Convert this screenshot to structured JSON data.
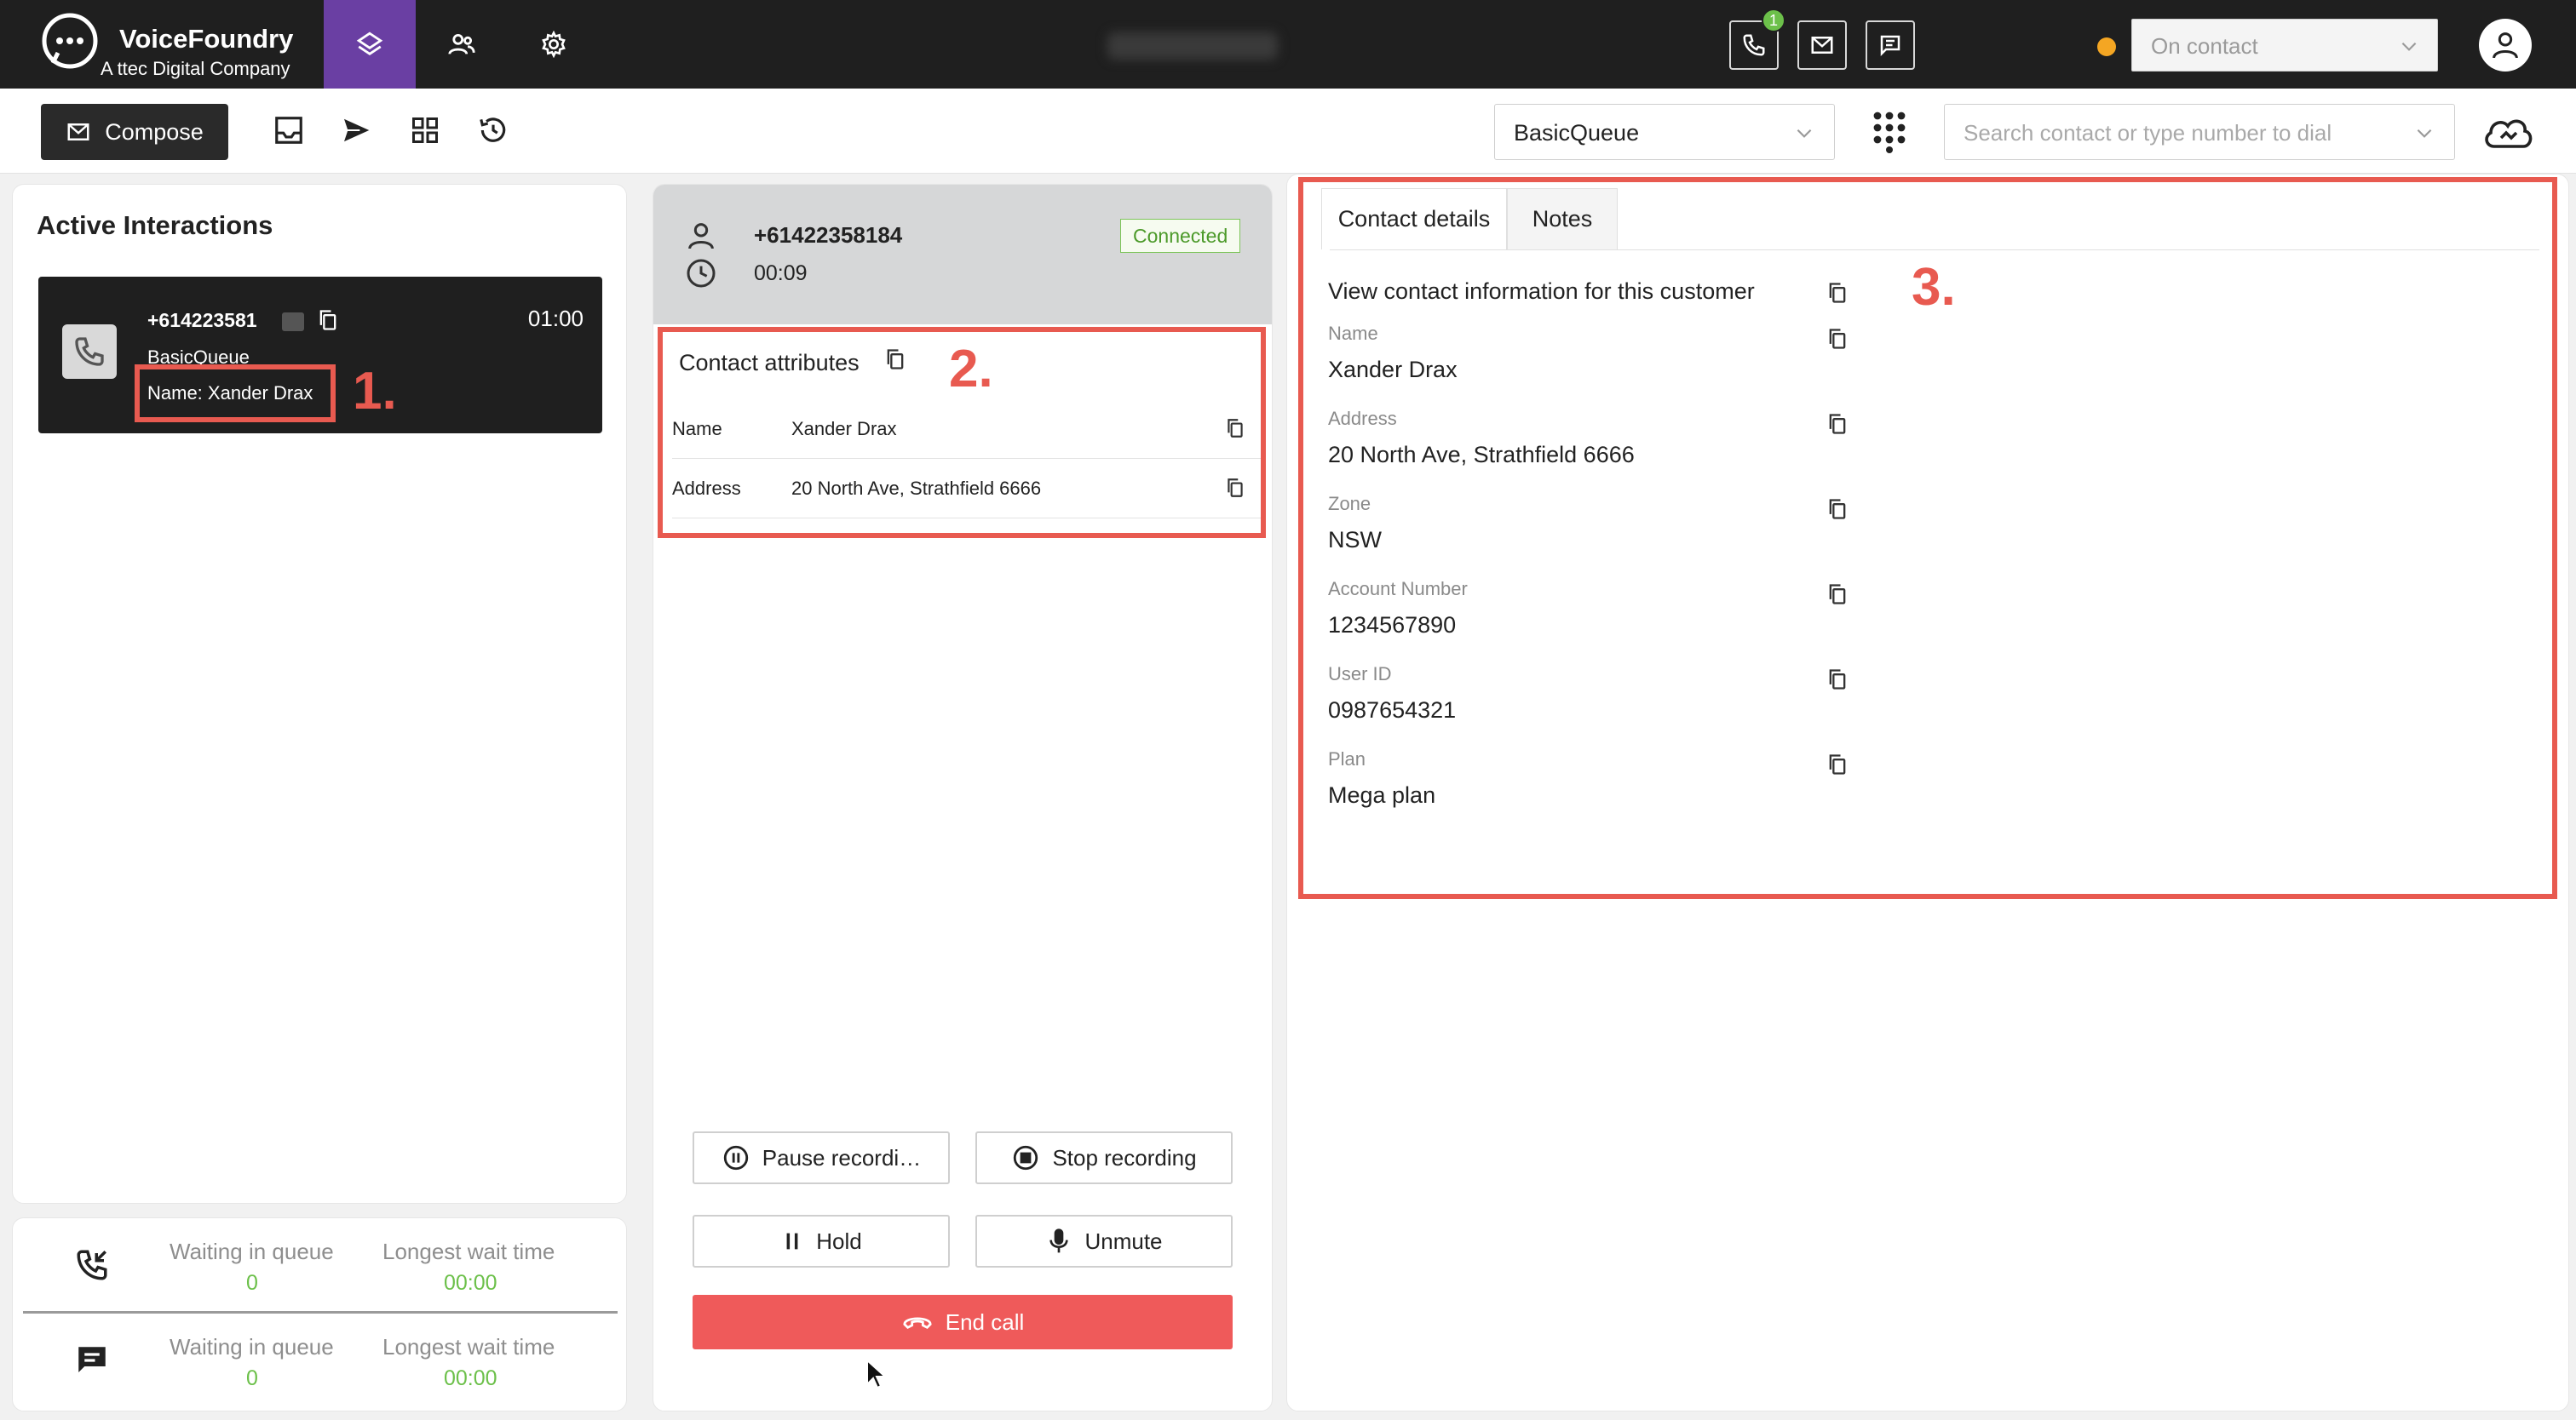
{
  "app": {
    "brand": "VoiceFoundry",
    "tagline": "A ttec Digital Company",
    "status": "On contact",
    "phone_badge": "1"
  },
  "toolbar": {
    "compose_label": "Compose",
    "queue_selected": "BasicQueue",
    "search_placeholder": "Search contact or type number to dial"
  },
  "left": {
    "title": "Active Interactions",
    "interaction": {
      "number": "+614223581",
      "time": "01:00",
      "queue": "BasicQueue",
      "name": "Name: Xander Drax"
    },
    "stats": [
      {
        "label_waiting": "Waiting in queue",
        "waiting": "0",
        "label_longest": "Longest wait time",
        "longest": "00:00"
      },
      {
        "label_waiting": "Waiting in queue",
        "waiting": "0",
        "label_longest": "Longest wait time",
        "longest": "00:00"
      }
    ]
  },
  "call": {
    "number": "+61422358184",
    "duration": "00:09",
    "status": "Connected",
    "attributes_title": "Contact attributes",
    "attributes": [
      {
        "key": "Name",
        "value": "Xander Drax"
      },
      {
        "key": "Address",
        "value": "20 North Ave, Strathfield 6666"
      }
    ],
    "buttons": {
      "pause": "Pause recordi…",
      "stop": "Stop recording",
      "hold": "Hold",
      "unmute": "Unmute",
      "end": "End call"
    }
  },
  "details": {
    "tabs": [
      "Contact details",
      "Notes"
    ],
    "intro": "View contact information for this customer",
    "fields": [
      {
        "label": "Name",
        "value": "Xander Drax"
      },
      {
        "label": "Address",
        "value": "20 North Ave, Strathfield 6666"
      },
      {
        "label": "Zone",
        "value": "NSW"
      },
      {
        "label": "Account Number",
        "value": "1234567890"
      },
      {
        "label": "User ID",
        "value": "0987654321"
      },
      {
        "label": "Plan",
        "value": "Mega plan"
      }
    ]
  },
  "annotations": [
    "1.",
    "2.",
    "3."
  ],
  "colors": {
    "accent_purple": "#6a3fa3",
    "connected_green": "#4c9a2a",
    "end_call_red": "#ef5a5a",
    "annotation_red": "#e85a50",
    "status_orange": "#f4a623"
  }
}
